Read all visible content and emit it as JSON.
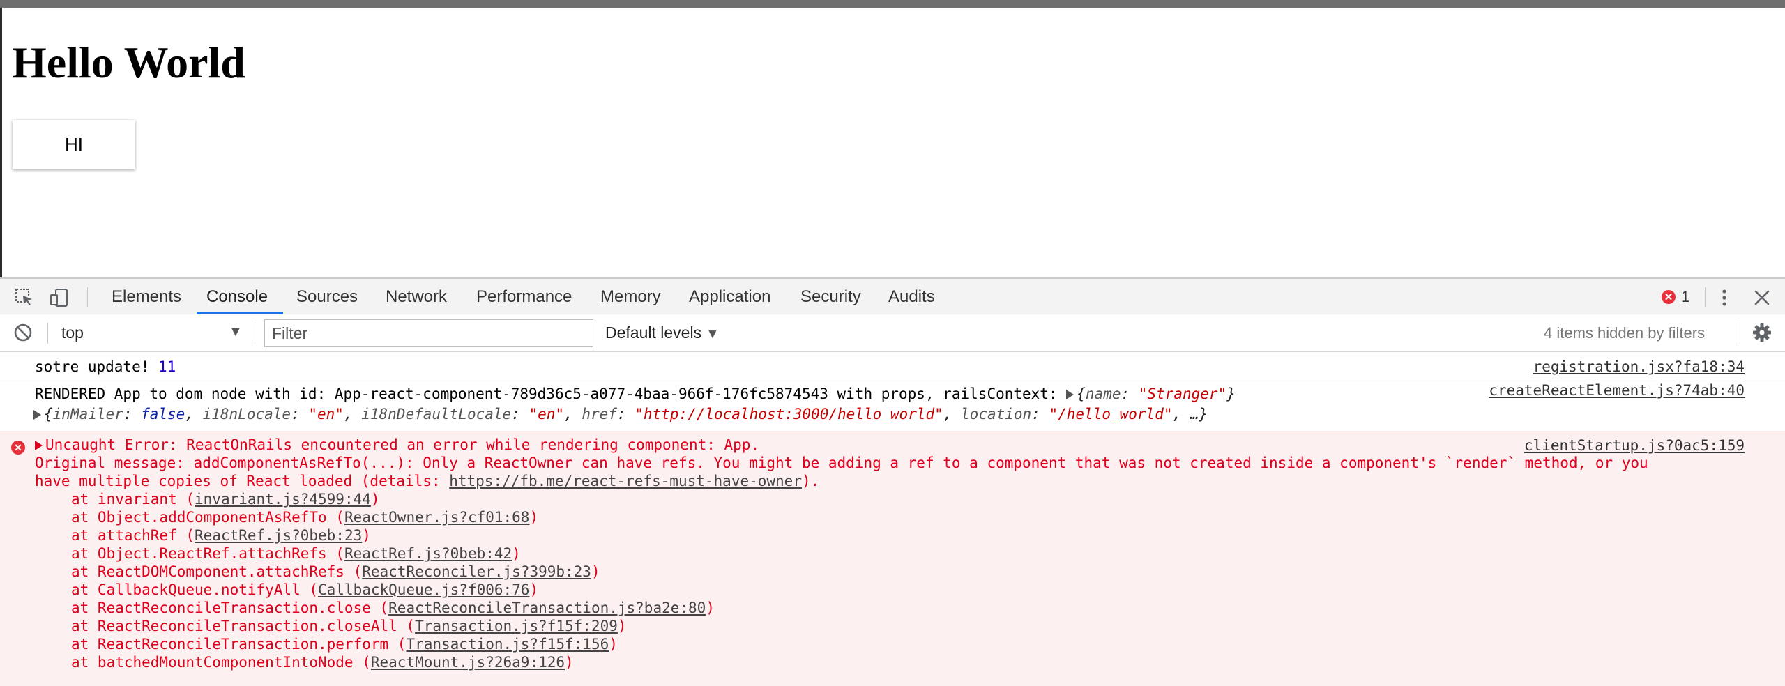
{
  "page": {
    "heading": "Hello World",
    "button_label": "HI"
  },
  "devtools": {
    "tabs": [
      "Elements",
      "Console",
      "Sources",
      "Network",
      "Performance",
      "Memory",
      "Application",
      "Security",
      "Audits"
    ],
    "active_tab": "Console",
    "error_count": "1",
    "accent_color": "#1a73e8",
    "error_color": "#e8303b",
    "toolbar_icons": [
      "inspect-element-icon",
      "device-toolbar-icon",
      "more-menu-icon",
      "close-icon"
    ],
    "filterbar": {
      "context": "top",
      "filter_placeholder": "Filter",
      "levels": "Default levels",
      "hidden_note": "4 items hidden by filters"
    }
  },
  "console": {
    "msg1": {
      "text": "sotre update! ",
      "number": "11",
      "source": "registration.jsx?fa18:34"
    },
    "msg2": {
      "text": "RENDERED App to dom node with id: App-react-component-789d36c5-a077-4baa-966f-176fc5874543 with props, railsContext: ",
      "obj1_open": "{",
      "obj1_key": "name",
      "obj1_val": "\"Stranger\"",
      "obj1_close": "}",
      "source": "createReactElement.js?74ab:40",
      "props": {
        "k1": "inMailer",
        "v1": "false",
        "k2": "i18nLocale",
        "v2": "\"en\"",
        "k3": "i18nDefaultLocale",
        "v3": "\"en\"",
        "k4": "href",
        "v4": "\"http://localhost:3000/hello_world\"",
        "k5": "location",
        "v5": "\"/hello_world\"",
        "tail": ", …}"
      }
    },
    "error": {
      "title": "Uncaught Error: ReactOnRails encountered an error while rendering component: App.",
      "source": "clientStartup.js?0ac5:159",
      "message_line1": "Original message: addComponentAsRefTo(...): Only a ReactOwner can have refs. You might be adding a ref to a component that was not created inside a component's `render` method, or you",
      "message_line2_prefix": "have multiple copies of React loaded (details: ",
      "message_link": "https://fb.me/react-refs-must-have-owner",
      "message_line2_suffix": ").",
      "stack": [
        {
          "fn": "at invariant (",
          "file": "invariant.js?4599:44"
        },
        {
          "fn": "at Object.addComponentAsRefTo (",
          "file": "ReactOwner.js?cf01:68"
        },
        {
          "fn": "at attachRef (",
          "file": "ReactRef.js?0beb:23"
        },
        {
          "fn": "at Object.ReactRef.attachRefs (",
          "file": "ReactRef.js?0beb:42"
        },
        {
          "fn": "at ReactDOMComponent.attachRefs (",
          "file": "ReactReconciler.js?399b:23"
        },
        {
          "fn": "at CallbackQueue.notifyAll (",
          "file": "CallbackQueue.js?f006:76"
        },
        {
          "fn": "at ReactReconcileTransaction.close (",
          "file": "ReactReconcileTransaction.js?ba2e:80"
        },
        {
          "fn": "at ReactReconcileTransaction.closeAll (",
          "file": "Transaction.js?f15f:209"
        },
        {
          "fn": "at ReactReconcileTransaction.perform (",
          "file": "Transaction.js?f15f:156"
        },
        {
          "fn": "at batchedMountComponentIntoNode (",
          "file": "ReactMount.js?26a9:126"
        }
      ]
    }
  }
}
